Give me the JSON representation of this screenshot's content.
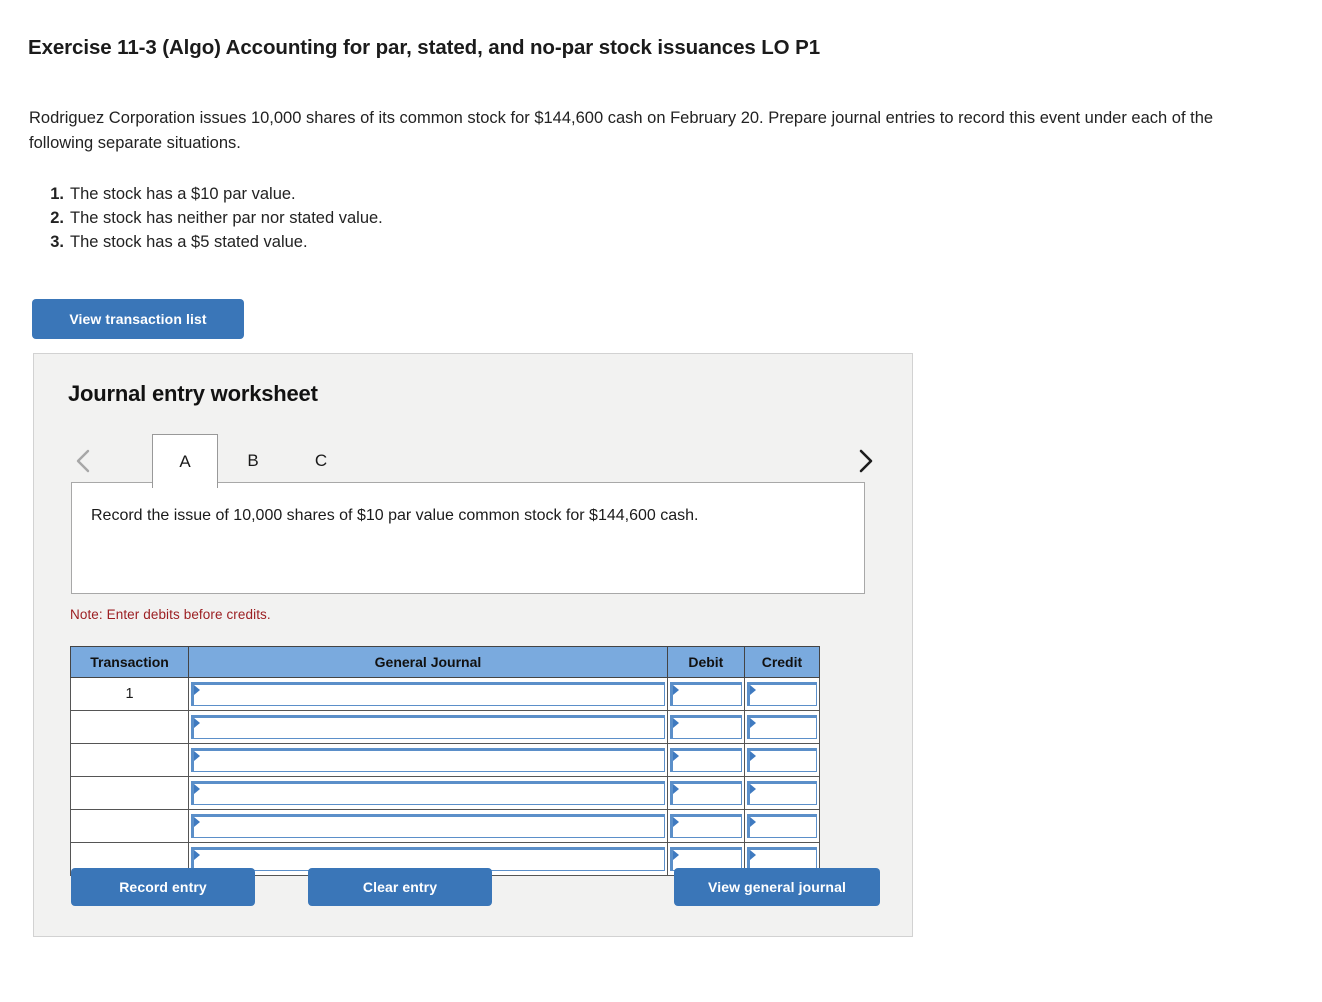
{
  "exercise": {
    "title": "Exercise 11-3 (Algo) Accounting for par, stated, and no-par stock issuances LO P1",
    "problem_text": "Rodriguez Corporation issues 10,000 shares of its common stock for $144,600 cash on February 20. Prepare journal entries to record this event under each of the following separate situations.",
    "situations": [
      {
        "num": "1.",
        "text": "The stock has a $10 par value."
      },
      {
        "num": "2.",
        "text": "The stock has neither par nor stated value."
      },
      {
        "num": "3.",
        "text": "The stock has a $5 stated value."
      }
    ]
  },
  "toolbar": {
    "view_transaction_list_label": "View transaction list"
  },
  "worksheet": {
    "title": "Journal entry worksheet",
    "nav": {
      "prev_icon": "chevron-left-icon",
      "next_icon": "chevron-right-icon",
      "prev_enabled": false,
      "next_enabled": true
    },
    "tabs": [
      {
        "label": "A",
        "active": true
      },
      {
        "label": "B",
        "active": false
      },
      {
        "label": "C",
        "active": false
      }
    ],
    "description": "Record the issue of 10,000 shares of $10 par value common stock for $144,600 cash.",
    "note": "Note: Enter debits before credits.",
    "table": {
      "columns": [
        "Transaction",
        "General Journal",
        "Debit",
        "Credit"
      ],
      "rows": [
        {
          "transaction": "1",
          "general_journal": "",
          "debit": "",
          "credit": ""
        },
        {
          "transaction": "",
          "general_journal": "",
          "debit": "",
          "credit": ""
        },
        {
          "transaction": "",
          "general_journal": "",
          "debit": "",
          "credit": ""
        },
        {
          "transaction": "",
          "general_journal": "",
          "debit": "",
          "credit": ""
        },
        {
          "transaction": "",
          "general_journal": "",
          "debit": "",
          "credit": ""
        },
        {
          "transaction": "",
          "general_journal": "",
          "debit": "",
          "credit": ""
        }
      ]
    },
    "actions": {
      "record_entry_label": "Record entry",
      "clear_entry_label": "Clear entry",
      "view_general_journal_label": "View general journal"
    }
  },
  "colors": {
    "button_blue": "#3a76b8",
    "table_header_blue": "#7aaade",
    "field_border_blue": "#5b8fc9",
    "note_red": "#9c1f22",
    "panel_gray": "#f2f2f1"
  }
}
